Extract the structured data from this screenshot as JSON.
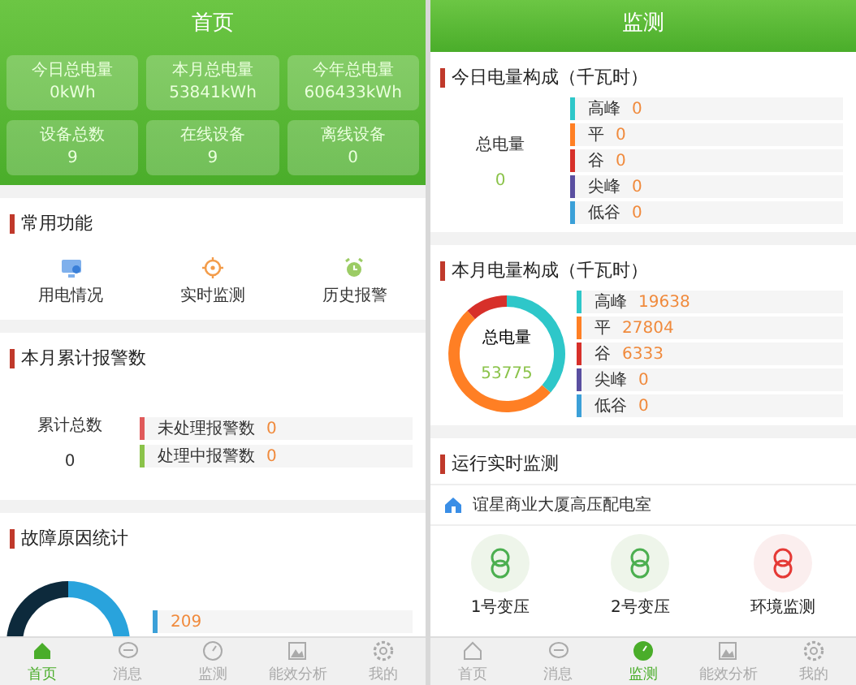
{
  "home_screen": {
    "title": "首页",
    "stats": [
      {
        "label": "今日总电量",
        "value": "0kWh"
      },
      {
        "label": "本月总电量",
        "value": "53841kWh"
      },
      {
        "label": "今年总电量",
        "value": "606433kWh"
      },
      {
        "label": "设备总数",
        "value": "9"
      },
      {
        "label": "在线设备",
        "value": "9"
      },
      {
        "label": "离线设备",
        "value": "0"
      }
    ],
    "shortcuts": {
      "title": "常用功能",
      "items": [
        {
          "label": "用电情况"
        },
        {
          "label": "实时监测"
        },
        {
          "label": "历史报警"
        }
      ]
    },
    "alarms": {
      "title": "本月累计报警数",
      "total_label": "累计总数",
      "total": "0",
      "items": [
        {
          "label": "未处理报警数",
          "value": "0",
          "color": "#e05a5a"
        },
        {
          "label": "处理中报警数",
          "value": "0",
          "color": "#8bc34a"
        }
      ]
    },
    "fault_causes": {
      "title": "故障原因统计",
      "items": [
        {
          "value": "209",
          "color": "#3ba0d8"
        }
      ]
    },
    "tabs": [
      {
        "label": "首页",
        "selected": true
      },
      {
        "label": "消息",
        "selected": false
      },
      {
        "label": "监测",
        "selected": false
      },
      {
        "label": "能效分析",
        "selected": false
      },
      {
        "label": "我的",
        "selected": false
      }
    ]
  },
  "monitor_screen": {
    "title": "监测",
    "today": {
      "title": "今日电量构成（千瓦时）",
      "total_label": "总电量",
      "total": "0",
      "items": [
        {
          "label": "高峰",
          "value": "0",
          "color": "#2ec7c9"
        },
        {
          "label": "平",
          "value": "0",
          "color": "#ff7f24"
        },
        {
          "label": "谷",
          "value": "0",
          "color": "#d7302a"
        },
        {
          "label": "尖峰",
          "value": "0",
          "color": "#5a4fa0"
        },
        {
          "label": "低谷",
          "value": "0",
          "color": "#3ba0d8"
        }
      ]
    },
    "month": {
      "title": "本月电量构成（千瓦时）",
      "total_label": "总电量",
      "total": "53775",
      "items": [
        {
          "label": "高峰",
          "value": "19638",
          "color": "#2ec7c9"
        },
        {
          "label": "平",
          "value": "27804",
          "color": "#ff7f24"
        },
        {
          "label": "谷",
          "value": "6333",
          "color": "#d7302a"
        },
        {
          "label": "尖峰",
          "value": "0",
          "color": "#5a4fa0"
        },
        {
          "label": "低谷",
          "value": "0",
          "color": "#3ba0d8"
        }
      ]
    },
    "realtime": {
      "title": "运行实时监测",
      "station": "谊星商业大厦高压配电室",
      "devices": [
        {
          "label": "1号变压",
          "alarm": false
        },
        {
          "label": "2号变压",
          "alarm": false
        },
        {
          "label": "环境监测",
          "alarm": true
        }
      ]
    },
    "tabs": [
      {
        "label": "首页",
        "selected": false
      },
      {
        "label": "消息",
        "selected": false
      },
      {
        "label": "监测",
        "selected": true
      },
      {
        "label": "能效分析",
        "selected": false
      },
      {
        "label": "我的",
        "selected": false
      }
    ]
  }
}
